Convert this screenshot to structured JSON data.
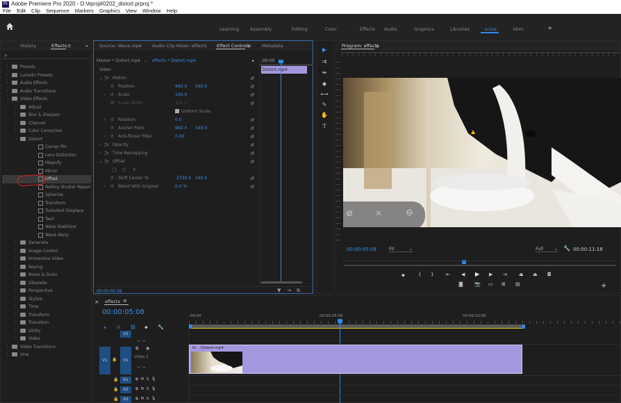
{
  "app": {
    "title": "Adobe Premiere Pro 2020 - D:\\#proj#0202_distort.prproj *",
    "logo": "Pr",
    "menus": [
      "File",
      "Edit",
      "Clip",
      "Sequence",
      "Markers",
      "Graphics",
      "View",
      "Window",
      "Help"
    ]
  },
  "workspaces": {
    "tabs": [
      "Learning",
      "Assembly",
      "Editing",
      "Color",
      "Effects",
      "Audio",
      "Graphics",
      "Libraries",
      "scine",
      "kbm"
    ],
    "active": "scine",
    "more": "»"
  },
  "left_panel": {
    "tabs": [
      "History",
      "Effects"
    ],
    "more": "»",
    "search_placeholder": "",
    "tree": [
      {
        "label": "Presets",
        "indent": 0,
        "kind": "folder",
        "arrow": "›"
      },
      {
        "label": "Lumetri Presets",
        "indent": 0,
        "kind": "folder",
        "arrow": "›"
      },
      {
        "label": "Audio Effects",
        "indent": 0,
        "kind": "folder",
        "arrow": "›"
      },
      {
        "label": "Audio Transitions",
        "indent": 0,
        "kind": "folder",
        "arrow": "›"
      },
      {
        "label": "Video Effects",
        "indent": 0,
        "kind": "folder",
        "arrow": "⌄"
      },
      {
        "label": "Adjust",
        "indent": 1,
        "kind": "folder",
        "arrow": "›"
      },
      {
        "label": "Blur & Sharpen",
        "indent": 1,
        "kind": "folder",
        "arrow": "›"
      },
      {
        "label": "Channel",
        "indent": 1,
        "kind": "folder",
        "arrow": "›"
      },
      {
        "label": "Color Correction",
        "indent": 1,
        "kind": "folder",
        "arrow": "›"
      },
      {
        "label": "Distort",
        "indent": 1,
        "kind": "folder",
        "arrow": "⌄"
      },
      {
        "label": "Corner Pin",
        "indent": 2,
        "kind": "fx",
        "arrow": ""
      },
      {
        "label": "Lens Distortion",
        "indent": 2,
        "kind": "fx",
        "arrow": ""
      },
      {
        "label": "Magnify",
        "indent": 2,
        "kind": "fx",
        "arrow": ""
      },
      {
        "label": "Mirror",
        "indent": 2,
        "kind": "fx",
        "arrow": ""
      },
      {
        "label": "Offset",
        "indent": 2,
        "kind": "fx",
        "arrow": "",
        "selected": true
      },
      {
        "label": "Rolling Shutter Repair",
        "indent": 2,
        "kind": "fx",
        "arrow": ""
      },
      {
        "label": "Spherize",
        "indent": 2,
        "kind": "fx",
        "arrow": ""
      },
      {
        "label": "Transform",
        "indent": 2,
        "kind": "fx",
        "arrow": ""
      },
      {
        "label": "Turbulent Displace",
        "indent": 2,
        "kind": "fx",
        "arrow": ""
      },
      {
        "label": "Twirl",
        "indent": 2,
        "kind": "fx",
        "arrow": ""
      },
      {
        "label": "Warp Stabilizer",
        "indent": 2,
        "kind": "fx",
        "arrow": ""
      },
      {
        "label": "Wave Warp",
        "indent": 2,
        "kind": "fx",
        "arrow": ""
      },
      {
        "label": "Generate",
        "indent": 1,
        "kind": "folder",
        "arrow": "›"
      },
      {
        "label": "Image Control",
        "indent": 1,
        "kind": "folder",
        "arrow": "›"
      },
      {
        "label": "Immersive Video",
        "indent": 1,
        "kind": "folder",
        "arrow": "›"
      },
      {
        "label": "Keying",
        "indent": 1,
        "kind": "folder",
        "arrow": "›"
      },
      {
        "label": "Noise & Grain",
        "indent": 1,
        "kind": "folder",
        "arrow": "›"
      },
      {
        "label": "Obsolete",
        "indent": 1,
        "kind": "folder",
        "arrow": "›"
      },
      {
        "label": "Perspective",
        "indent": 1,
        "kind": "folder",
        "arrow": "›"
      },
      {
        "label": "Stylize",
        "indent": 1,
        "kind": "folder",
        "arrow": "›"
      },
      {
        "label": "Time",
        "indent": 1,
        "kind": "folder",
        "arrow": "›"
      },
      {
        "label": "Transform",
        "indent": 1,
        "kind": "folder",
        "arrow": "›"
      },
      {
        "label": "Transition",
        "indent": 1,
        "kind": "folder",
        "arrow": "›"
      },
      {
        "label": "Utility",
        "indent": 1,
        "kind": "folder",
        "arrow": "›"
      },
      {
        "label": "Video",
        "indent": 1,
        "kind": "folder",
        "arrow": "›"
      },
      {
        "label": "Video Transitions",
        "indent": 0,
        "kind": "folder",
        "arrow": "›"
      },
      {
        "label": "zine",
        "indent": 0,
        "kind": "folder",
        "arrow": "›"
      }
    ]
  },
  "effect_controls": {
    "tabs": [
      "Source: Wave.mp4",
      "Audio Clip Mixer: effects",
      "Effect Controls",
      "Metadata"
    ],
    "active_tab": "Effect Controls",
    "master": "Master * Distort.mp4",
    "sequence_clip": "effects * Distort.mp4",
    "section": "Video",
    "mini_time": ":00:00",
    "clip_label": "Distort.mp4",
    "footer_time": "00:00:05:08",
    "rows": [
      {
        "kind": "group",
        "label": "Motion",
        "fx": true,
        "twirl": "⌄"
      },
      {
        "kind": "prop",
        "label": "Position",
        "v1": "960.0",
        "v2": "540.0"
      },
      {
        "kind": "prop",
        "label": "Scale",
        "v1": "100.0",
        "v2": "",
        "twirl": "›"
      },
      {
        "kind": "prop",
        "label": "Scale Width",
        "v1": "100.0",
        "v2": "",
        "dim": true
      },
      {
        "kind": "check",
        "label": "Uniform Scale"
      },
      {
        "kind": "prop",
        "label": "Rotation",
        "v1": "0.0",
        "v2": "",
        "twirl": "›"
      },
      {
        "kind": "prop",
        "label": "Anchor Point",
        "v1": "960.0",
        "v2": "540.0"
      },
      {
        "kind": "prop",
        "label": "Anti-flicker Filter",
        "v1": "0.00",
        "v2": "",
        "twirl": "›"
      },
      {
        "kind": "group",
        "label": "Opacity",
        "fx": true,
        "twirl": "›"
      },
      {
        "kind": "group",
        "label": "Time Remapping",
        "fx": true,
        "twirl": "›"
      },
      {
        "kind": "group",
        "label": "Offset",
        "fx": true,
        "twirl": "⌄"
      },
      {
        "kind": "masks",
        "label": ""
      },
      {
        "kind": "prop",
        "label": "Shift Center To",
        "v1": "-2730.0",
        "v2": "540.0"
      },
      {
        "kind": "prop",
        "label": "Blend With Original",
        "v1": "0.0 %",
        "v2": "",
        "twirl": "›"
      }
    ]
  },
  "program": {
    "title": "Program: effects",
    "timecode": "00:00:05:08",
    "fit": "Fit",
    "quality": "Full",
    "duration": "00:00:11:18"
  },
  "timeline": {
    "title": "effects",
    "timecode": "00:00:05:08",
    "ruler": [
      ":00:00",
      "00:00:05:00",
      "00:00:10:00"
    ],
    "tracks": [
      {
        "src": "",
        "name": "V2",
        "label": ""
      },
      {
        "src": "V1",
        "name": "V1",
        "label": "Video 1"
      },
      {
        "src": "",
        "name": "A1",
        "label": ""
      },
      {
        "src": "",
        "name": "A2",
        "label": ""
      },
      {
        "src": "",
        "name": "A3",
        "label": ""
      }
    ],
    "clip_label": "Distort.mp4",
    "track_buttons": [
      "M",
      "S"
    ]
  },
  "colors": {
    "accent": "#2d8ceb",
    "clip": "#a597de",
    "value": "#3c8fe3",
    "annotation": "#e02020"
  }
}
